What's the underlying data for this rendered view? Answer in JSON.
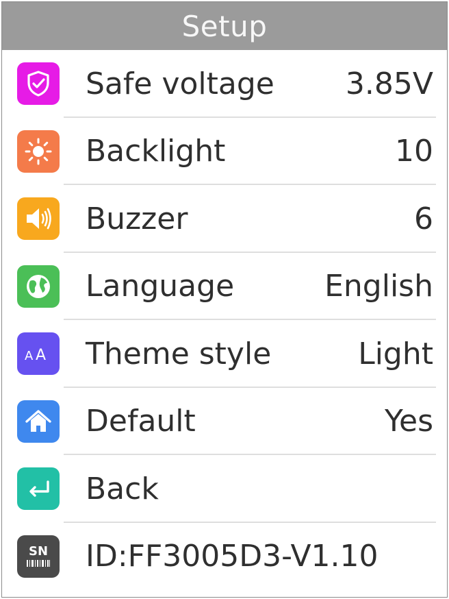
{
  "title": "Setup",
  "colors": {
    "titlebar_bg": "#9b9b9b",
    "safe_voltage_icon": "#e61be6",
    "backlight_icon": "#f47b4a",
    "buzzer_icon": "#f8a81e",
    "language_icon": "#4bbf57",
    "theme_icon": "#6651f0",
    "default_icon": "#3f88ee",
    "back_icon": "#22c0a6",
    "id_icon": "#4a4a4a"
  },
  "items": [
    {
      "label": "Safe voltage",
      "value": "3.85V",
      "icon": "shield-icon"
    },
    {
      "label": "Backlight",
      "value": "10",
      "icon": "sun-icon"
    },
    {
      "label": "Buzzer",
      "value": "6",
      "icon": "speaker-icon"
    },
    {
      "label": "Language",
      "value": "English",
      "icon": "globe-icon"
    },
    {
      "label": "Theme style",
      "value": "Light",
      "icon": "font-size-icon"
    },
    {
      "label": "Default",
      "value": "Yes",
      "icon": "home-icon"
    },
    {
      "label": "Back",
      "value": "",
      "icon": "return-icon"
    },
    {
      "label": "ID:FF3005D3-V1.10",
      "value": "",
      "icon": "serial-number-icon",
      "icon_text": "SN"
    }
  ]
}
